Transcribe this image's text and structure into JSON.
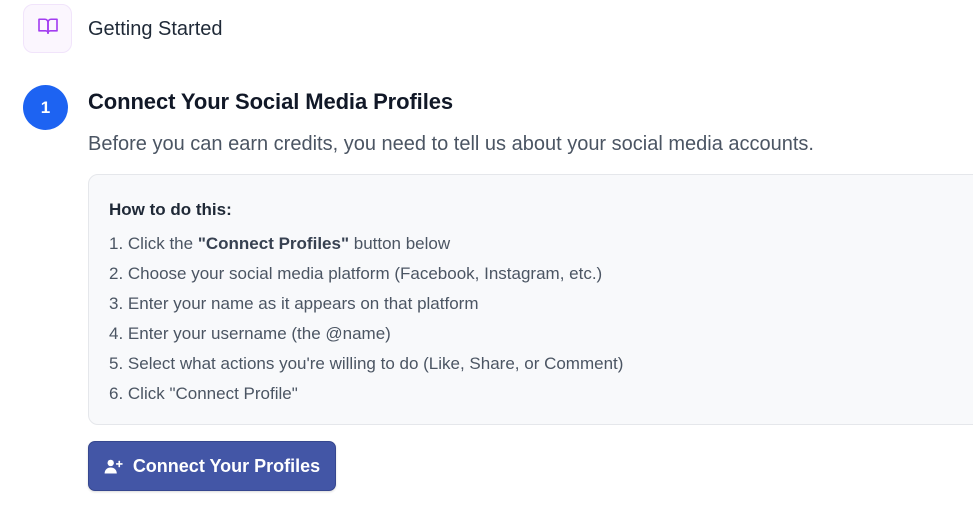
{
  "header": {
    "icon": "book-open-icon",
    "title": "Getting Started"
  },
  "step": {
    "number": "1",
    "title": "Connect Your Social Media Profiles",
    "description": "Before you can earn credits, you need to tell us about your social media accounts."
  },
  "instructions": {
    "heading": "How to do this:",
    "items": [
      {
        "prefix": "1. Click the ",
        "bold": "\"Connect Profiles\"",
        "suffix": " button below"
      },
      {
        "prefix": "2. Choose your social media platform (Facebook, Instagram, etc.)",
        "bold": "",
        "suffix": ""
      },
      {
        "prefix": "3. Enter your name as it appears on that platform",
        "bold": "",
        "suffix": ""
      },
      {
        "prefix": "4. Enter your username (the @name)",
        "bold": "",
        "suffix": ""
      },
      {
        "prefix": "5. Select what actions you're willing to do (Like, Share, or Comment)",
        "bold": "",
        "suffix": ""
      },
      {
        "prefix": "6. Click \"Connect Profile\"",
        "bold": "",
        "suffix": ""
      }
    ]
  },
  "button": {
    "icon": "user-plus-icon",
    "label": "Connect Your Profiles"
  },
  "colors": {
    "accent_purple": "#a23cf0",
    "step_blue": "#1d63f2",
    "button_indigo": "#4356a6"
  }
}
